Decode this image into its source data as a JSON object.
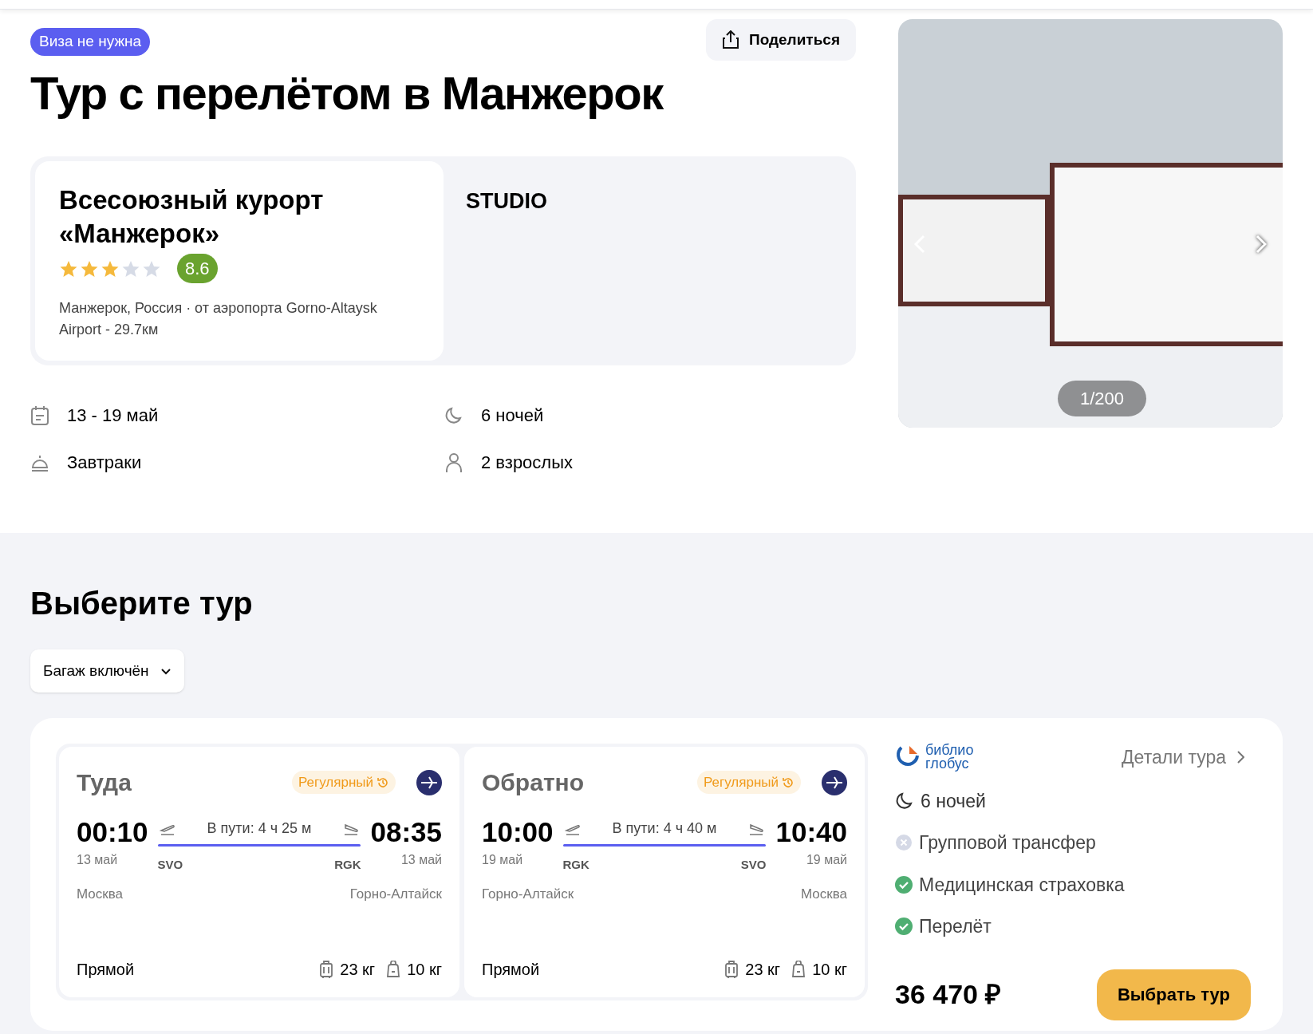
{
  "badge": "Виза не нужна",
  "share_button": "Поделиться",
  "title": "Тур с перелётом в Манжерок",
  "hotel": {
    "name": "Всесоюзный курорт «Манжерок»",
    "stars": 3,
    "rating": "8.6",
    "location": "Манжерок, Россия · от аэропорта Gorno-Altaysk Airport - 29.7км",
    "room": "STUDIO"
  },
  "photo": {
    "counter": "1/200"
  },
  "facts": [
    {
      "kind": "calendar",
      "text": "13 - 19 май"
    },
    {
      "kind": "moon",
      "text": "6 ночей"
    },
    {
      "kind": "meal",
      "text": "Завтраки"
    },
    {
      "kind": "person",
      "text": "2 взрослых"
    }
  ],
  "section_title": "Выберите тур",
  "filter": "Багаж включён",
  "flights": [
    {
      "direction": "Туда",
      "type": "Регулярный",
      "depart_time": "00:10",
      "depart_date": "13 май",
      "depart_code": "SVO",
      "depart_city": "Москва",
      "duration": "В пути: 4 ч 25 м",
      "arrive_time": "08:35",
      "arrive_date": "13 май",
      "arrive_code": "RGK",
      "arrive_city": "Горно-Алтайск",
      "stops": "Прямой",
      "baggage": "23 кг",
      "hand_luggage": "10 кг"
    },
    {
      "direction": "Обратно",
      "type": "Регулярный",
      "depart_time": "10:00",
      "depart_date": "19 май",
      "depart_code": "RGK",
      "depart_city": "Горно-Алтайск",
      "duration": "В пути: 4 ч 40 м",
      "arrive_time": "10:40",
      "arrive_date": "19 май",
      "arrive_code": "SVO",
      "arrive_city": "Москва",
      "stops": "Прямой",
      "baggage": "23 кг",
      "hand_luggage": "10 кг"
    }
  ],
  "operator": {
    "logo_text": [
      "библио",
      "глобус"
    ],
    "details_link": "Детали тура",
    "nights": "6 ночей",
    "inclusions": [
      {
        "text": "Групповой трансфер",
        "included": false
      },
      {
        "text": "Медицинская страховка",
        "included": true
      },
      {
        "text": "Перелёт",
        "included": true
      }
    ],
    "price": "36 470 ₽",
    "select_button": "Выбрать тур"
  }
}
